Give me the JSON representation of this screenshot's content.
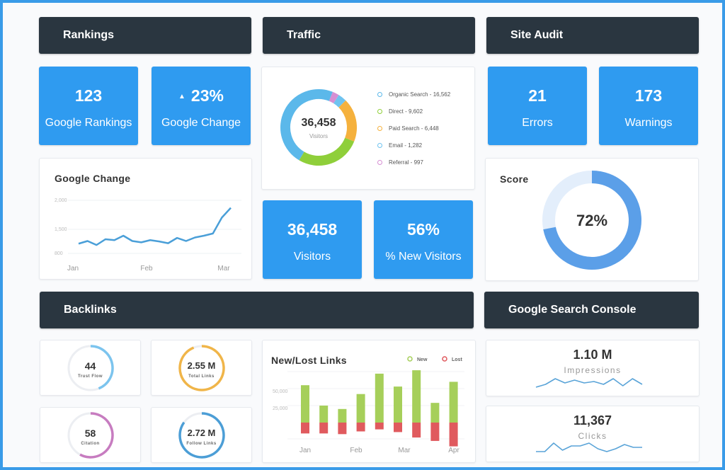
{
  "sections": {
    "rankings": "Rankings",
    "traffic": "Traffic",
    "site_audit": "Site Audit",
    "backlinks": "Backlinks",
    "gsc": "Google Search Console"
  },
  "rankings": {
    "tiles": [
      {
        "value": "123",
        "label": "Google Rankings"
      },
      {
        "value": "23%",
        "label": "Google Change",
        "trend_icon": "triangle-up"
      }
    ],
    "chart_title": "Google Change"
  },
  "traffic": {
    "center_value": "36,458",
    "center_label": "Visitors",
    "legend": [
      {
        "label": "Organic Search - 16,562",
        "color": "#5bb8ea"
      },
      {
        "label": "Direct - 9,602",
        "color": "#8fcf3a"
      },
      {
        "label": "Paid Search - 6,448",
        "color": "#f5b13d"
      },
      {
        "label": "Email - 1,282",
        "color": "#6fc3ef"
      },
      {
        "label": "Referral - 997",
        "color": "#d68fd3"
      }
    ],
    "tiles": [
      {
        "value": "36,458",
        "label": "Visitors"
      },
      {
        "value": "56%",
        "label": "% New Visitors"
      }
    ]
  },
  "site_audit": {
    "tiles": [
      {
        "value": "21",
        "label": "Errors"
      },
      {
        "value": "173",
        "label": "Warnings"
      }
    ],
    "score_title": "Score",
    "score_value": "72%"
  },
  "backlinks": {
    "rings": [
      {
        "value": "44",
        "label": "Trust Flow",
        "fraction": 0.44,
        "color": "#7cc4ee"
      },
      {
        "value": "2.55 M",
        "label": "Total Links",
        "fraction": 0.94,
        "color": "#f0b549"
      },
      {
        "value": "58",
        "label": "Citation",
        "fraction": 0.58,
        "color": "#c77cc0"
      },
      {
        "value": "2.72 M",
        "label": "Follow Links",
        "fraction": 0.85,
        "color": "#4c9ed6"
      }
    ],
    "chart_title": "New/Lost Links"
  },
  "gsc": {
    "cards": [
      {
        "value": "1.10 M",
        "label": "Impressions"
      },
      {
        "value": "11,367",
        "label": "Clicks"
      }
    ]
  },
  "chart_data": [
    {
      "id": "google-change",
      "type": "line",
      "title": "Google Change",
      "x_tick_labels": [
        "Jan",
        "Feb",
        "Mar"
      ],
      "y_tick_labels": [
        "800",
        "1,500",
        "2,000"
      ],
      "ylim": [
        800,
        2000
      ],
      "grid": true,
      "color": "#4a9fd8",
      "values": [
        1020,
        1080,
        990,
        1120,
        1100,
        1200,
        1080,
        1050,
        1100,
        1070,
        1030,
        1150,
        1080,
        1160,
        1200,
        1250,
        1610,
        1830
      ]
    },
    {
      "id": "traffic-sources",
      "type": "pie",
      "title": "Traffic",
      "labels": [
        "Organic Search",
        "Direct",
        "Paid Search",
        "Email",
        "Referral"
      ],
      "values": [
        16562,
        9602,
        6448,
        1282,
        997
      ],
      "colors": [
        "#5bb8ea",
        "#8fcf3a",
        "#f5b13d",
        "#6fc3ef",
        "#d68fd3"
      ],
      "center_text": "36,458"
    },
    {
      "id": "site-score",
      "type": "pie",
      "title": "Score",
      "values": [
        72,
        28
      ],
      "labels": [
        "Score",
        "Remaining"
      ],
      "colors": [
        "#5b9fe8",
        "#e3eefb"
      ]
    },
    {
      "id": "new-lost-links",
      "type": "bar",
      "title": "New/Lost Links",
      "x_tick_labels": [
        "Jan",
        "Feb",
        "Mar",
        "Apr"
      ],
      "y_tick_labels": [
        "25,000",
        "50,000"
      ],
      "legend": [
        "New",
        "Lost"
      ],
      "legend_position": "top-right",
      "series": [
        {
          "name": "New",
          "color": "#a6cf5a",
          "values": [
            55000,
            25000,
            20000,
            42000,
            72000,
            53000,
            77000,
            29000,
            60000
          ]
        },
        {
          "name": "Lost",
          "color": "#e05a5e",
          "values": [
            -16000,
            -16000,
            -17000,
            -13000,
            -10000,
            -14000,
            -22000,
            -27000,
            -35000
          ]
        }
      ],
      "ylim": [
        -35000,
        75000
      ]
    },
    {
      "id": "impressions-spark",
      "type": "line",
      "title": "Impressions",
      "color": "#5aa4d8",
      "values": [
        3,
        5,
        9,
        6,
        8,
        6,
        7,
        5,
        9,
        4,
        9,
        5
      ]
    },
    {
      "id": "clicks-spark",
      "type": "line",
      "title": "Clicks",
      "color": "#5aa4d8",
      "values": [
        3,
        3,
        9,
        4,
        7,
        7,
        9,
        5,
        3,
        5,
        8,
        6,
        6
      ]
    }
  ]
}
